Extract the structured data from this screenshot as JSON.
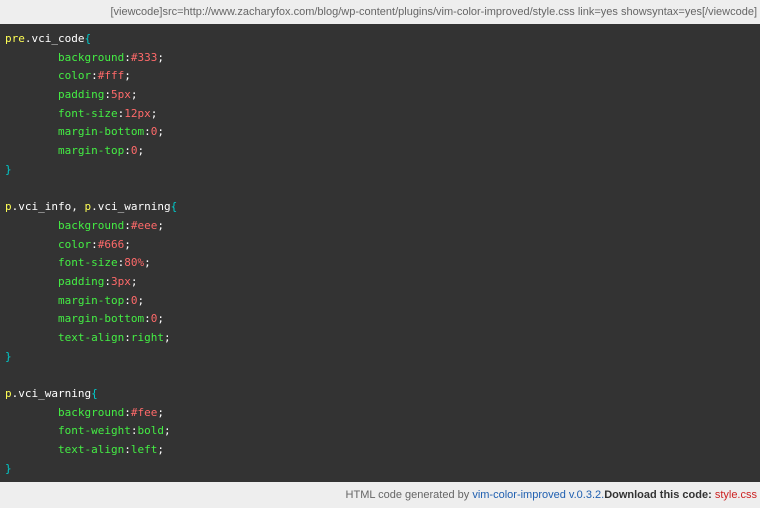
{
  "info_bar": {
    "text": "[viewcode]src=http://www.zacharyfox.com/blog/wp-content/plugins/vim-color-improved/style.css link=yes showsyntax=yes[/viewcode]"
  },
  "code_lines": [
    [
      [
        "sel",
        "pre"
      ],
      [
        "cls",
        ".vci_code"
      ],
      [
        "brace",
        "{"
      ]
    ],
    [
      [
        "pad",
        "        "
      ],
      [
        "prop",
        "background"
      ],
      [
        "colon",
        ":"
      ],
      [
        "val",
        "#333"
      ],
      [
        "semi",
        ";"
      ]
    ],
    [
      [
        "pad",
        "        "
      ],
      [
        "prop",
        "color"
      ],
      [
        "colon",
        ":"
      ],
      [
        "val",
        "#fff"
      ],
      [
        "semi",
        ";"
      ]
    ],
    [
      [
        "pad",
        "        "
      ],
      [
        "prop",
        "padding"
      ],
      [
        "colon",
        ":"
      ],
      [
        "val",
        "5px"
      ],
      [
        "semi",
        ";"
      ]
    ],
    [
      [
        "pad",
        "        "
      ],
      [
        "prop",
        "font-size"
      ],
      [
        "colon",
        ":"
      ],
      [
        "val",
        "12px"
      ],
      [
        "semi",
        ";"
      ]
    ],
    [
      [
        "pad",
        "        "
      ],
      [
        "prop",
        "margin-bottom"
      ],
      [
        "colon",
        ":"
      ],
      [
        "val",
        "0"
      ],
      [
        "semi",
        ";"
      ]
    ],
    [
      [
        "pad",
        "        "
      ],
      [
        "prop",
        "margin-top"
      ],
      [
        "colon",
        ":"
      ],
      [
        "val",
        "0"
      ],
      [
        "semi",
        ";"
      ]
    ],
    [
      [
        "brace",
        "}"
      ]
    ],
    [],
    [
      [
        "sel",
        "p"
      ],
      [
        "cls",
        ".vci_info"
      ],
      [
        "punct",
        ", "
      ],
      [
        "sel",
        "p"
      ],
      [
        "cls",
        ".vci_warning"
      ],
      [
        "brace",
        "{"
      ]
    ],
    [
      [
        "pad",
        "        "
      ],
      [
        "prop",
        "background"
      ],
      [
        "colon",
        ":"
      ],
      [
        "val",
        "#eee"
      ],
      [
        "semi",
        ";"
      ]
    ],
    [
      [
        "pad",
        "        "
      ],
      [
        "prop",
        "color"
      ],
      [
        "colon",
        ":"
      ],
      [
        "val",
        "#666"
      ],
      [
        "semi",
        ";"
      ]
    ],
    [
      [
        "pad",
        "        "
      ],
      [
        "prop",
        "font-size"
      ],
      [
        "colon",
        ":"
      ],
      [
        "val",
        "80%"
      ],
      [
        "semi",
        ";"
      ]
    ],
    [
      [
        "pad",
        "        "
      ],
      [
        "prop",
        "padding"
      ],
      [
        "colon",
        ":"
      ],
      [
        "val",
        "3px"
      ],
      [
        "semi",
        ";"
      ]
    ],
    [
      [
        "pad",
        "        "
      ],
      [
        "prop",
        "margin-top"
      ],
      [
        "colon",
        ":"
      ],
      [
        "val",
        "0"
      ],
      [
        "semi",
        ";"
      ]
    ],
    [
      [
        "pad",
        "        "
      ],
      [
        "prop",
        "margin-bottom"
      ],
      [
        "colon",
        ":"
      ],
      [
        "val",
        "0"
      ],
      [
        "semi",
        ";"
      ]
    ],
    [
      [
        "pad",
        "        "
      ],
      [
        "prop",
        "text-align"
      ],
      [
        "colon",
        ":"
      ],
      [
        "kw",
        "right"
      ],
      [
        "semi",
        ";"
      ]
    ],
    [
      [
        "brace",
        "}"
      ]
    ],
    [],
    [
      [
        "sel",
        "p"
      ],
      [
        "cls",
        ".vci_warning"
      ],
      [
        "brace",
        "{"
      ]
    ],
    [
      [
        "pad",
        "        "
      ],
      [
        "prop",
        "background"
      ],
      [
        "colon",
        ":"
      ],
      [
        "val",
        "#fee"
      ],
      [
        "semi",
        ";"
      ]
    ],
    [
      [
        "pad",
        "        "
      ],
      [
        "prop",
        "font-weight"
      ],
      [
        "colon",
        ":"
      ],
      [
        "kw",
        "bold"
      ],
      [
        "semi",
        ";"
      ]
    ],
    [
      [
        "pad",
        "        "
      ],
      [
        "prop",
        "text-align"
      ],
      [
        "colon",
        ":"
      ],
      [
        "kw",
        "left"
      ],
      [
        "semi",
        ";"
      ]
    ],
    [
      [
        "brace",
        "}"
      ]
    ]
  ],
  "footer": {
    "generated_prefix": "HTML code generated by ",
    "generator_link": "vim-color-improved",
    "version": " v.0.3.2.",
    "download_label": "Download this code:",
    "download_link": "style.css"
  },
  "colors": {
    "code_background": "#333333",
    "bar_background": "#eeeeee",
    "selector": "#ffff55",
    "property": "#44ee44",
    "value": "#ff6a6a",
    "brace": "#00cccc",
    "link_blue": "#1f5fb0",
    "link_red": "#cc2222"
  }
}
